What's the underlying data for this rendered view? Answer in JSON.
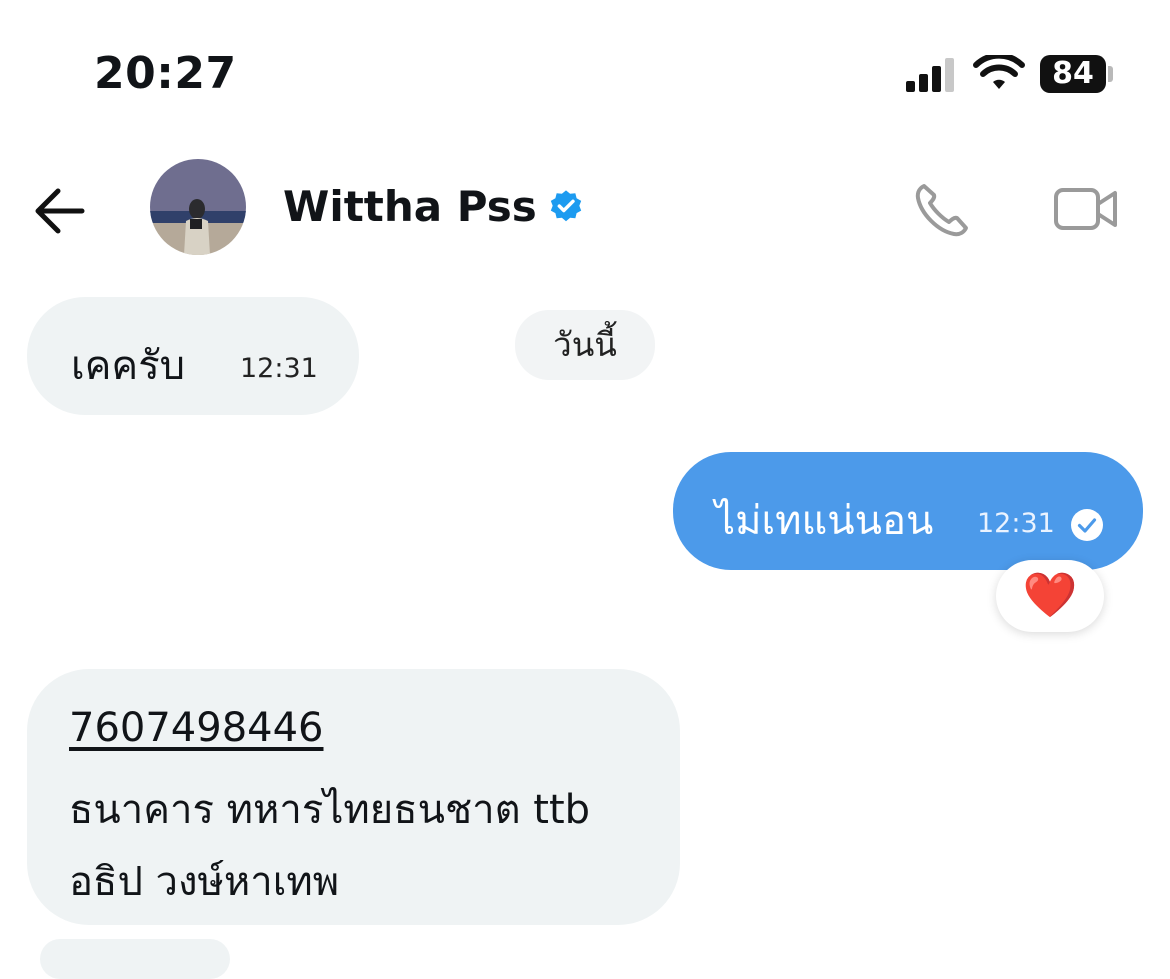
{
  "status_bar": {
    "time": "20:27",
    "battery": "84"
  },
  "header": {
    "name": "Wittha Pss",
    "verified": true,
    "icons": [
      "back-arrow-icon",
      "phone-icon",
      "video-camera-icon",
      "verified-badge-icon"
    ]
  },
  "date_separator": "วันนี้",
  "messages": [
    {
      "direction": "incoming",
      "text": "เคครับ",
      "time": "12:31"
    },
    {
      "direction": "outgoing",
      "text": "ไม่เทแน่นอน",
      "time": "12:31",
      "read": true,
      "reaction": "❤️"
    },
    {
      "direction": "incoming",
      "lines": [
        "7607498446",
        "ธนาคาร ทหารไทยธนชาต ttb",
        "อธิป วงษ์หาเทพ"
      ]
    }
  ],
  "colors": {
    "outgoing_bubble": "#4c9aea",
    "incoming_bubble": "#eff3f4",
    "verified": "#1d9bf0"
  }
}
